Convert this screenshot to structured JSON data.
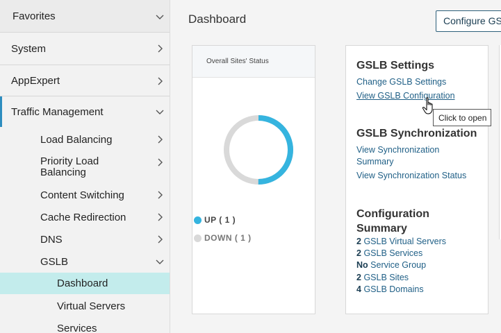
{
  "sidebar": {
    "favorites": "Favorites",
    "system": "System",
    "appexpert": "AppExpert",
    "traffic_management": "Traffic Management",
    "load_balancing": "Load Balancing",
    "priority_load_balancing_line1": "Priority Load",
    "priority_load_balancing_line2": "Balancing",
    "content_switching": "Content Switching",
    "cache_redirection": "Cache Redirection",
    "dns": "DNS",
    "gslb": "GSLB",
    "dashboard": "Dashboard",
    "virtual_servers": "Virtual Servers",
    "services": "Services"
  },
  "header": {
    "title": "Dashboard",
    "configure_button": "Configure GSLB"
  },
  "sites_status": {
    "title": "Overall Sites' Status",
    "up_label": "UP ( 1 )",
    "down_label": "DOWN ( 1 )",
    "up_count": 1,
    "down_count": 1,
    "up_color": "#35b4df",
    "down_color": "#d9d9d9"
  },
  "gslb_settings": {
    "title": "GSLB Settings",
    "change_link": "Change GSLB Settings",
    "view_link": "View GSLB Configuration"
  },
  "gslb_sync": {
    "title": "GSLB Synchronization",
    "view_sync_summary_line1": "View Synchronization",
    "view_sync_summary_line2": "Summary",
    "view_sync_status": "View Synchronization Status"
  },
  "config_summary": {
    "title_line1": "Configuration",
    "title_line2": "Summary",
    "rows": [
      {
        "count": "2",
        "label": "GSLB Virtual Servers"
      },
      {
        "count": "2",
        "label": "GSLB Services"
      },
      {
        "count": "No",
        "label": "Service Group"
      },
      {
        "count": "2",
        "label": "GSLB Sites"
      },
      {
        "count": "4",
        "label": "GSLB Domains"
      }
    ]
  },
  "tooltip": "Click to open",
  "icons": {
    "chevron_right": "chevron-right-icon",
    "chevron_down": "chevron-down-icon",
    "cursor": "hand-pointer-icon"
  }
}
